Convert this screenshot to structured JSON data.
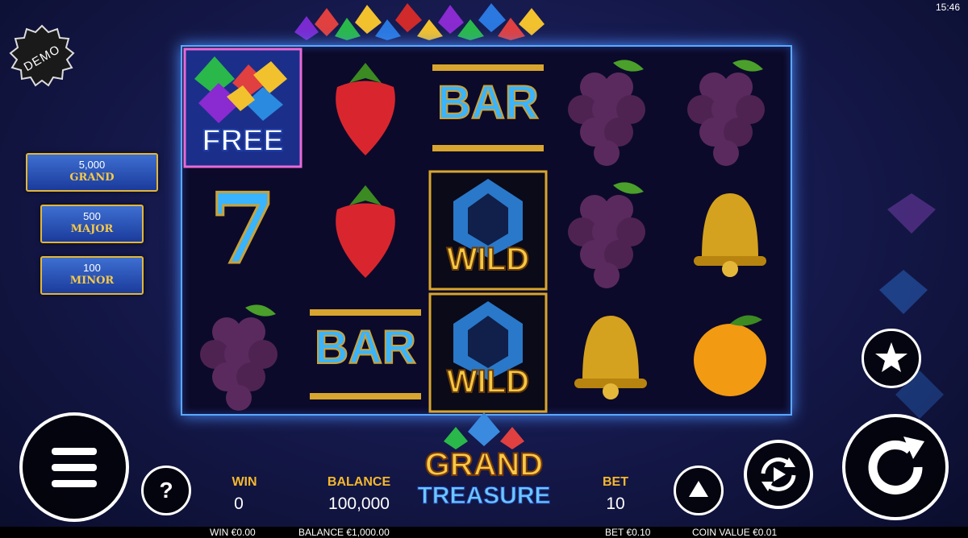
{
  "status": {
    "clock": "15:46"
  },
  "demo": {
    "label": "DEMO"
  },
  "jackpots": [
    {
      "amount": "5,000",
      "label": "GRAND"
    },
    {
      "amount": "500",
      "label": "MAJOR"
    },
    {
      "amount": "100",
      "label": "MINOR"
    }
  ],
  "reels": {
    "free_label": "FREE",
    "wild_label": "WILD",
    "bar_label": "BAR",
    "seven_label": "7"
  },
  "logo": {
    "line1": "GRAND",
    "line2": "TREASURE"
  },
  "hud": {
    "win_label": "WIN",
    "win_value": "0",
    "balance_label": "BALANCE",
    "balance_value": "100,000",
    "bet_label": "BET",
    "bet_value": "10"
  },
  "help": {
    "label": "?"
  },
  "footer": {
    "win": "WIN €0.00",
    "balance": "BALANCE €1,000.00",
    "bet": "BET €0.10",
    "coin_value": "COIN VALUE €0.01"
  },
  "colors": {
    "accent": "#f5b82e",
    "reel_border": "#5aa9ff",
    "jackpot_border": "#e3b636"
  }
}
